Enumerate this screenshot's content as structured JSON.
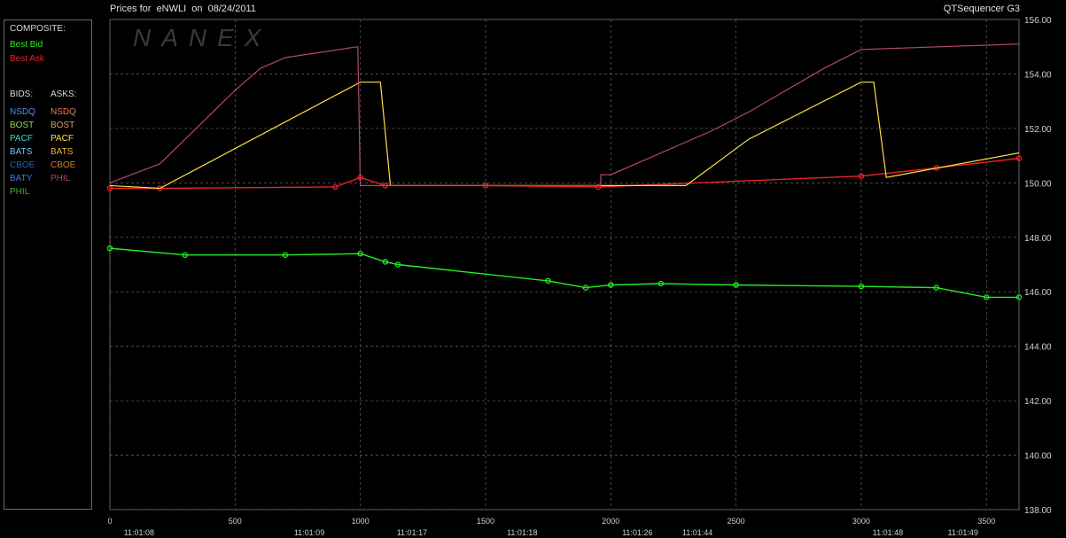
{
  "header": {
    "title": "Prices for  eNWLI  on  08/24/2011",
    "app_name": "QTSequencer G3"
  },
  "watermark": "NANEX",
  "legend": {
    "composite_title": "COMPOSITE:",
    "best_bid": "Best Bid",
    "best_ask": "Best Ask",
    "bids_title": "BIDS:",
    "asks_title": "ASKS:",
    "bids": [
      {
        "label": "NSDQ",
        "color": "#4f8fe8"
      },
      {
        "label": "BOST",
        "color": "#8fcf6a"
      },
      {
        "label": "PACF",
        "color": "#3fd8c8"
      },
      {
        "label": "BATS",
        "color": "#6cc8f8"
      },
      {
        "label": "CBOE",
        "color": "#2e5fc8"
      },
      {
        "label": "BATY",
        "color": "#4a7ad8"
      },
      {
        "label": "PHIL",
        "color": "#4aa83a"
      }
    ],
    "asks": [
      {
        "label": "NSDQ",
        "color": "#f07850"
      },
      {
        "label": "BOST",
        "color": "#e0a070"
      },
      {
        "label": "PACF",
        "color": "#ffe040"
      },
      {
        "label": "BATS",
        "color": "#f0b040"
      },
      {
        "label": "CBOE",
        "color": "#d08030"
      },
      {
        "label": "PHIL",
        "color": "#b04870"
      }
    ],
    "colors": {
      "best_bid": "#22ee22",
      "best_ask": "#ee2222",
      "text": "#d0d0d0"
    }
  },
  "chart_data": {
    "type": "line",
    "x_ticks": [
      0,
      500,
      1000,
      1500,
      2000,
      2500,
      3000,
      3500
    ],
    "x_time_labels": [
      {
        "x": 10,
        "label": "11:01:08"
      },
      {
        "x": 690,
        "label": "11:01:09"
      },
      {
        "x": 1100,
        "label": "11:01:17"
      },
      {
        "x": 1540,
        "label": "11:01:18"
      },
      {
        "x": 2000,
        "label": "11:01:26"
      },
      {
        "x": 2240,
        "label": "11:01:44"
      },
      {
        "x": 3000,
        "label": "11:01:48"
      },
      {
        "x": 3300,
        "label": "11:01:49"
      }
    ],
    "xlim": [
      0,
      3630
    ],
    "ylim": [
      138,
      156
    ],
    "y_ticks": [
      "138.00",
      "140.00",
      "142.00",
      "144.00",
      "146.00",
      "148.00",
      "150.00",
      "152.00",
      "154.00",
      "156.00"
    ],
    "grid": true,
    "series": [
      {
        "name": "Best Bid",
        "color": "#22ee22",
        "points": [
          [
            0,
            147.6
          ],
          [
            300,
            147.35
          ],
          [
            700,
            147.35
          ],
          [
            1000,
            147.4
          ],
          [
            1100,
            147.1
          ],
          [
            1150,
            147.0
          ],
          [
            1750,
            146.4
          ],
          [
            1900,
            146.15
          ],
          [
            2000,
            146.25
          ],
          [
            2200,
            146.3
          ],
          [
            2500,
            146.25
          ],
          [
            3000,
            146.2
          ],
          [
            3300,
            146.15
          ],
          [
            3500,
            145.8
          ],
          [
            3630,
            145.8
          ]
        ]
      },
      {
        "name": "Best Ask",
        "color": "#ee2222",
        "points": [
          [
            0,
            149.8
          ],
          [
            200,
            149.8
          ],
          [
            900,
            149.85
          ],
          [
            1000,
            150.2
          ],
          [
            1100,
            149.9
          ],
          [
            1500,
            149.9
          ],
          [
            1950,
            149.85
          ],
          [
            3000,
            150.25
          ],
          [
            3300,
            150.55
          ],
          [
            3630,
            150.9
          ]
        ]
      },
      {
        "name": "PACF",
        "color": "#ffe040",
        "points": [
          [
            0,
            149.9
          ],
          [
            200,
            149.8
          ],
          [
            1000,
            153.7
          ],
          [
            1080,
            153.7
          ],
          [
            1120,
            149.9
          ],
          [
            1950,
            149.9
          ],
          [
            2300,
            149.9
          ],
          [
            2550,
            151.6
          ],
          [
            3000,
            153.7
          ],
          [
            3050,
            153.7
          ],
          [
            3100,
            150.2
          ],
          [
            3630,
            151.1
          ]
        ]
      },
      {
        "name": "PHIL",
        "color": "#b04870",
        "points": [
          [
            0,
            150.0
          ],
          [
            200,
            150.7
          ],
          [
            300,
            151.6
          ],
          [
            400,
            152.5
          ],
          [
            500,
            153.4
          ],
          [
            600,
            154.2
          ],
          [
            700,
            154.6
          ],
          [
            990,
            155.0
          ],
          [
            1000,
            149.9
          ],
          [
            1960,
            149.9
          ],
          [
            1960,
            150.3
          ],
          [
            2000,
            150.3
          ],
          [
            2100,
            150.7
          ],
          [
            2250,
            151.3
          ],
          [
            2400,
            151.9
          ],
          [
            2550,
            152.6
          ],
          [
            2700,
            153.4
          ],
          [
            2850,
            154.2
          ],
          [
            3000,
            154.9
          ],
          [
            3630,
            155.1
          ]
        ]
      }
    ]
  }
}
